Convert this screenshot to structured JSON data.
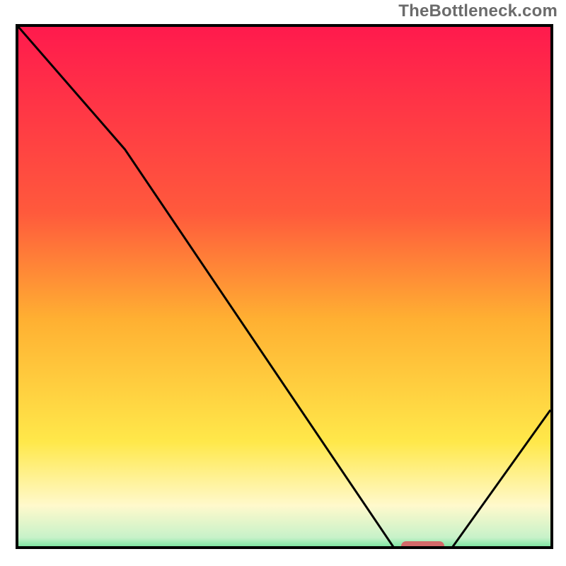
{
  "watermark": "TheBottleneck.com",
  "colors": {
    "frame": "#000000",
    "curve": "#000000",
    "marker": "#d46a6a",
    "grad_top": "#ff1a4d",
    "grad_upper": "#ff5a3c",
    "grad_mid": "#ffb032",
    "grad_lower": "#ffe84a",
    "grad_pale": "#fff9cc",
    "grad_green_pale": "#c7f2c9",
    "grad_green": "#17d46b"
  },
  "chart_data": {
    "type": "line",
    "title": "",
    "xlabel": "",
    "ylabel": "",
    "xlim": [
      0,
      100
    ],
    "ylim": [
      0,
      100
    ],
    "x": [
      0,
      20,
      72,
      80,
      100
    ],
    "values": [
      100,
      77,
      0,
      0,
      28
    ],
    "marker": {
      "x_start": 72,
      "x_end": 80,
      "y": 0
    },
    "gradient_stops": [
      {
        "pos": 0.0,
        "color_key": "grad_top"
      },
      {
        "pos": 0.35,
        "color_key": "grad_upper"
      },
      {
        "pos": 0.55,
        "color_key": "grad_mid"
      },
      {
        "pos": 0.78,
        "color_key": "grad_lower"
      },
      {
        "pos": 0.9,
        "color_key": "grad_pale"
      },
      {
        "pos": 0.96,
        "color_key": "grad_green_pale"
      },
      {
        "pos": 1.0,
        "color_key": "grad_green"
      }
    ]
  }
}
